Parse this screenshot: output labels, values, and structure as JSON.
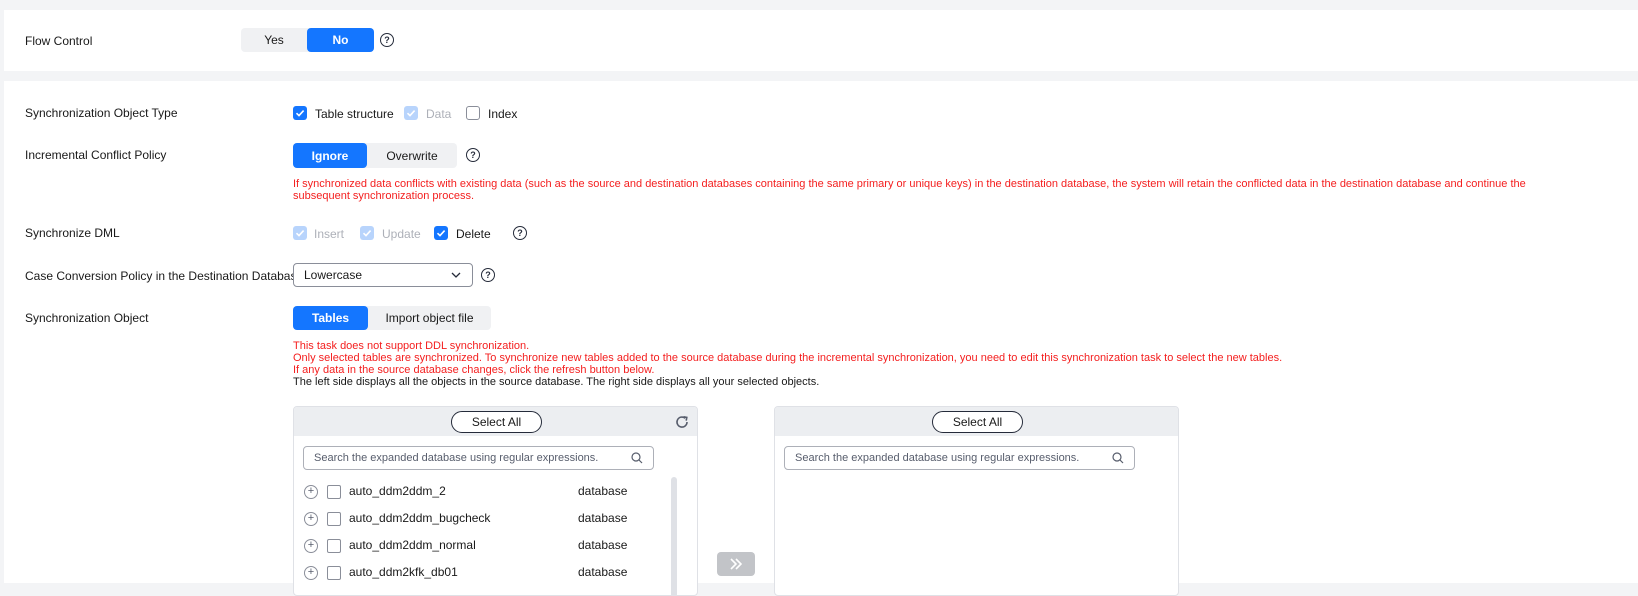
{
  "flow_control": {
    "label": "Flow Control",
    "options": [
      "Yes",
      "No"
    ],
    "selected": "No"
  },
  "object_type": {
    "label": "Synchronization Object Type",
    "items": [
      {
        "label": "Table structure",
        "state": "checked"
      },
      {
        "label": "Data",
        "state": "checked-disabled"
      },
      {
        "label": "Index",
        "state": "unchecked"
      }
    ]
  },
  "conflict_policy": {
    "label": "Incremental Conflict Policy",
    "options": [
      "Ignore",
      "Overwrite"
    ],
    "selected": "Ignore",
    "note": "If synchronized data conflicts with existing data (such as the source and destination databases containing the same primary or unique keys) in the destination database, the system will retain the conflicted data in the destination database and continue the subsequent synchronization process."
  },
  "sync_dml": {
    "label": "Synchronize DML",
    "items": [
      {
        "label": "Insert",
        "state": "checked-disabled"
      },
      {
        "label": "Update",
        "state": "checked-disabled"
      },
      {
        "label": "Delete",
        "state": "checked"
      }
    ]
  },
  "case_policy": {
    "label": "Case Conversion Policy in the Destination Database",
    "value": "Lowercase"
  },
  "sync_object": {
    "label": "Synchronization Object",
    "options": [
      "Tables",
      "Import object file"
    ],
    "selected": "Tables",
    "notes": [
      "This task does not support DDL synchronization.",
      "Only selected tables are synchronized. To synchronize new tables added to the source database during the incremental synchronization, you need to edit this synchronization task to select the new tables.",
      "If any data in the source database changes, click the refresh button below."
    ],
    "info": "The left side displays all the objects in the source database. The right side displays all your selected objects."
  },
  "left_panel": {
    "select_all": "Select All",
    "search_placeholder": "Search the expanded database using regular expressions.",
    "rows": [
      {
        "name": "auto_ddm2ddm_2",
        "type": "database"
      },
      {
        "name": "auto_ddm2ddm_bugcheck",
        "type": "database"
      },
      {
        "name": "auto_ddm2ddm_normal",
        "type": "database"
      },
      {
        "name": "auto_ddm2kfk_db01",
        "type": "database"
      }
    ]
  },
  "right_panel": {
    "select_all": "Select All",
    "search_placeholder": "Search the expanded database using regular expressions."
  },
  "icons": {
    "help": "help-icon",
    "refresh": "refresh-icon",
    "search": "search-icon",
    "expand": "expand-icon",
    "chevron": "chevron-down-icon",
    "transfer": "double-chevron-right-icon"
  },
  "colors": {
    "primary": "#1476ff",
    "warning_text": "#f41e1e",
    "disabled_check": "#b8d4fc"
  }
}
